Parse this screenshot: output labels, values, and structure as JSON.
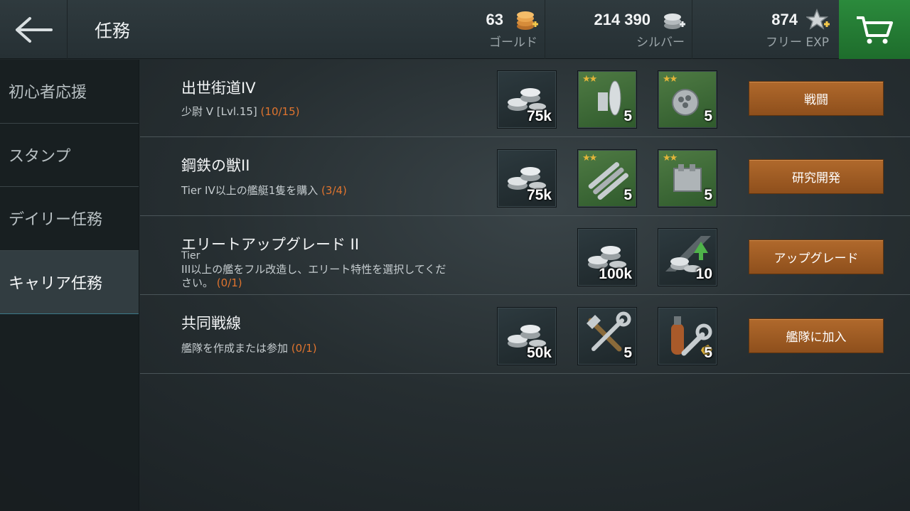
{
  "header": {
    "title": "任務",
    "gold": {
      "amount": "63",
      "label": "ゴールド",
      "icon": "gold-coins-plus-icon"
    },
    "silver": {
      "amount": "214 390",
      "label": "シルバー",
      "icon": "silver-coins-plus-icon"
    },
    "free_exp": {
      "amount": "874",
      "label": "フリー EXP",
      "icon": "star-plus-icon"
    },
    "back_icon": "back-arrow-icon",
    "cart_icon": "shopping-cart-icon"
  },
  "sidebar": {
    "items": [
      {
        "label": "初心者応援"
      },
      {
        "label": "スタンプ"
      },
      {
        "label": "デイリー任務"
      },
      {
        "label": "キャリア任務"
      }
    ],
    "active_index": 3
  },
  "missions": [
    {
      "title": "出世街道IV",
      "desc": "少尉 V [Lvl.15]",
      "progress": "(10/15)",
      "rewards": [
        {
          "icon": "silver-coins-icon",
          "count": "75k"
        },
        {
          "icon": "radar-module-icon",
          "count": "5",
          "stars": "★★"
        },
        {
          "icon": "gun-turret-module-icon",
          "count": "5",
          "stars": "★★"
        }
      ],
      "button": "戦闘"
    },
    {
      "title": "鋼鉄の獣II",
      "desc": "Tier IV以上の艦艇1隻を購入",
      "progress": "(3/4)",
      "rewards": [
        {
          "icon": "silver-coins-icon",
          "count": "75k"
        },
        {
          "icon": "torpedo-module-icon",
          "count": "5",
          "stars": "★★"
        },
        {
          "icon": "engine-module-icon",
          "count": "5",
          "stars": "★★"
        }
      ],
      "button": "研究開発"
    },
    {
      "title": "エリートアップグレード II",
      "desc_line1": "Tier",
      "desc_line2": "III以上の艦をフル改造し、エリート特性を選択してくだ",
      "desc_line3": "さい。",
      "progress": "(0/1)",
      "rewards": [
        {
          "icon": "silver-coins-icon",
          "count": "100k"
        },
        {
          "icon": "upgrade-coins-icon",
          "count": "10"
        }
      ],
      "button": "アップグレード"
    },
    {
      "title": "共同戦線",
      "desc": "艦隊を作成または参加",
      "progress": "(0/1)",
      "rewards": [
        {
          "icon": "silver-coins-icon",
          "count": "50k"
        },
        {
          "icon": "repair-tools-icon",
          "count": "5"
        },
        {
          "icon": "extinguisher-wrench-icon",
          "count": "5"
        }
      ],
      "button": "艦隊に加入"
    }
  ]
}
